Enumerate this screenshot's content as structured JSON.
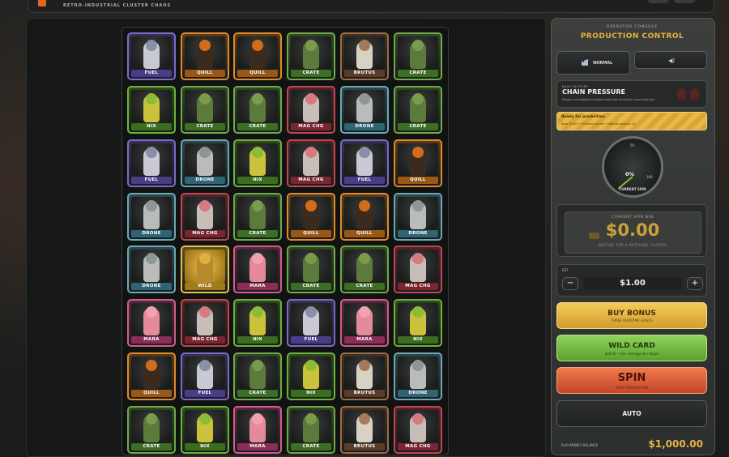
{
  "header": {
    "subtitle": "RETRO-INDUSTRIAL CLUSTER CHAOS"
  },
  "symbols": {
    "FUEL": {
      "border": "#7c6ac9",
      "label_bg": "#4b3c8a",
      "fig": "#c8c9d2",
      "head": "#8a8fa8"
    },
    "QUILL": {
      "border": "#e08a2a",
      "label_bg": "#9a5818",
      "fig": "#3b2a1e",
      "head": "#d06c1c"
    },
    "CRATE": {
      "border": "#6faa4a",
      "label_bg": "#3d6e26",
      "fig": "#5c7a3c",
      "head": "#7a9a4c"
    },
    "BRUTUS": {
      "border": "#9b6c48",
      "label_bg": "#5a3c28",
      "fig": "#d9d2c4",
      "head": "#a57a5a"
    },
    "NIX": {
      "border": "#6cb33a",
      "label_bg": "#3a6e1e",
      "fig": "#c9c23a",
      "head": "#8dbb35"
    },
    "MAG CHG": {
      "border": "#c24652",
      "label_bg": "#7a2530",
      "fig": "#c9bdb8",
      "head": "#d67a80"
    },
    "DRONE": {
      "border": "#6aa8b8",
      "label_bg": "#2f6474",
      "fig": "#b9bcb8",
      "head": "#8d9796"
    },
    "WILD": {
      "border": "#e8c24a",
      "label_bg": "#a07c18",
      "fig": "#b68a2a",
      "head": "#e0b040"
    },
    "MARA": {
      "border": "#d65a8e",
      "label_bg": "#8a2e58",
      "fig": "#e48a9a",
      "head": "#f0a2b2"
    }
  },
  "grid": [
    [
      "FUEL",
      "QUILL",
      "QUILL",
      "CRATE",
      "BRUTUS",
      "CRATE"
    ],
    [
      "NIX",
      "CRATE",
      "CRATE",
      "MAG CHG",
      "DRONE",
      "CRATE"
    ],
    [
      "FUEL",
      "DRONE",
      "NIX",
      "MAG CHG",
      "FUEL",
      "QUILL"
    ],
    [
      "DRONE",
      "MAG CHG",
      "CRATE",
      "QUILL",
      "QUILL",
      "DRONE"
    ],
    [
      "DRONE",
      "WILD",
      "MARA",
      "CRATE",
      "CRATE",
      "MAG CHG"
    ],
    [
      "MARA",
      "MAG CHG",
      "NIX",
      "FUEL",
      "MARA",
      "NIX"
    ],
    [
      "QUILL",
      "FUEL",
      "CRATE",
      "NIX",
      "BRUTUS",
      "DRONE"
    ],
    [
      "CRATE",
      "NIX",
      "MARA",
      "CRATE",
      "BRUTUS",
      "MAG CHG"
    ]
  ],
  "console": {
    "eyebrow": "OPERATOR CONSOLE",
    "title": "PRODUCTION CONTROL",
    "speed_label": "NORMAL",
    "factory_eyebrow": "BASE FACTORY",
    "factory_title": "CHAIN PRESSURE",
    "factory_desc": "Pressure and position multipliers exist only during the current paid spin.",
    "ready_title": "Ready for production",
    "ready_desc": "Base 5/100 • 0 Factory alarms • Highest position 1×",
    "gauge_value": "0%",
    "gauge_progress": 0,
    "gauge_tick_50": "50",
    "gauge_tick_100": "100",
    "gauge_label": "CURRENT SPIN",
    "win_eyebrow": "CURRENT SPIN WIN",
    "win_amount": "$0.00",
    "win_status": "WAITING FOR A MATCHING CLUSTER",
    "bet_label": "BET",
    "bet_value": "$1.00",
    "minus": "−",
    "plus": "+",
    "buy_bonus": "BUY BONUS",
    "buy_bonus_sub": "THREE OVERTIME LEVELS",
    "wild_card": "WILD CARD",
    "wild_card_sub": "$20.00 • 10× average win target",
    "spin": "SPIN",
    "spin_sub": "START PRODUCTION",
    "auto": "AUTO",
    "balance_label": "PLAY-MONEY BALANCE",
    "balance": "$1,000.00"
  }
}
